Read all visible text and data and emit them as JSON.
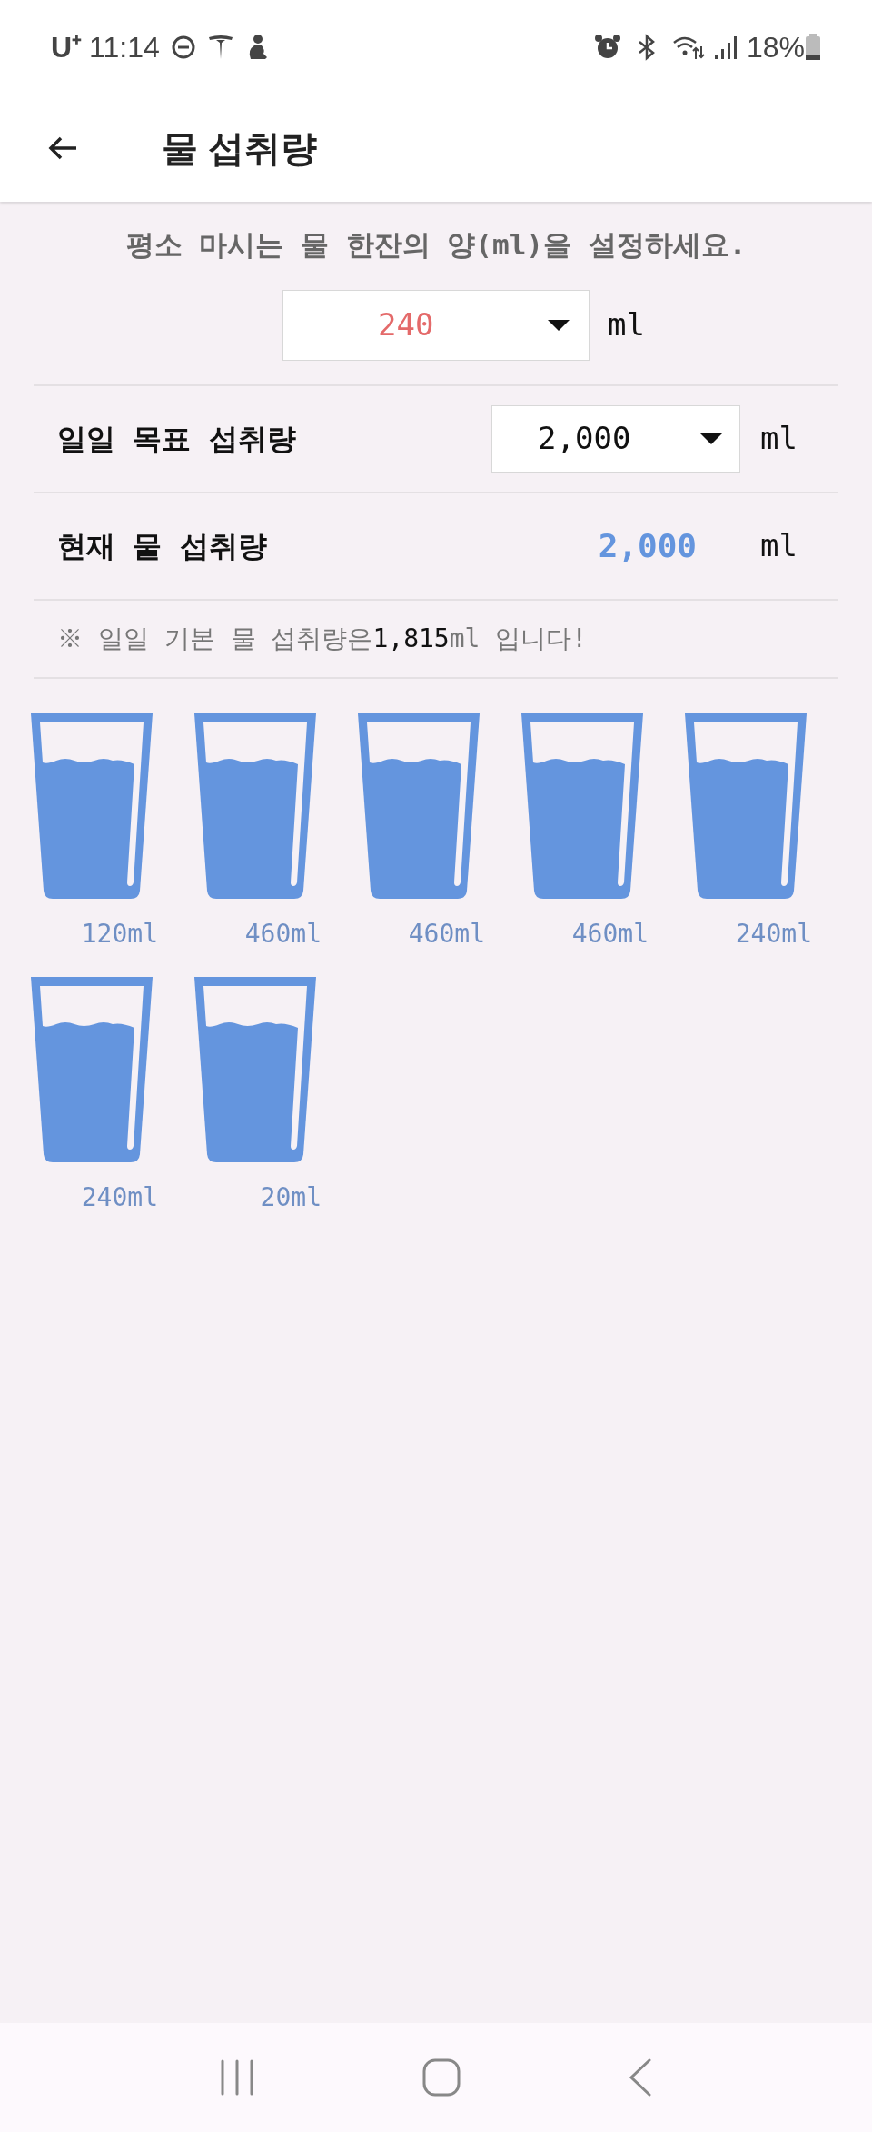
{
  "status_bar": {
    "carrier": "U⁺",
    "time": "11:14",
    "battery": "18%"
  },
  "header": {
    "title": "물 섭취량"
  },
  "cup_setting": {
    "instruction": "평소 마시는 물 한잔의 양(ml)을 설정하세요.",
    "value": "240",
    "unit": "ml"
  },
  "daily_goal": {
    "label": "일일 목표 섭취량",
    "value": "2,000",
    "unit": "ml"
  },
  "current_intake": {
    "label": "현재 물 섭취량",
    "value": "2,000",
    "unit": "ml"
  },
  "note": {
    "prefix": "※ 일일 기본 물 섭취량은",
    "value": "1,815",
    "suffix": "ml 입니다!"
  },
  "glasses": [
    {
      "label": "120ml"
    },
    {
      "label": "460ml"
    },
    {
      "label": "460ml"
    },
    {
      "label": "460ml"
    },
    {
      "label": "240ml"
    },
    {
      "label": "240ml"
    },
    {
      "label": "20ml"
    }
  ]
}
